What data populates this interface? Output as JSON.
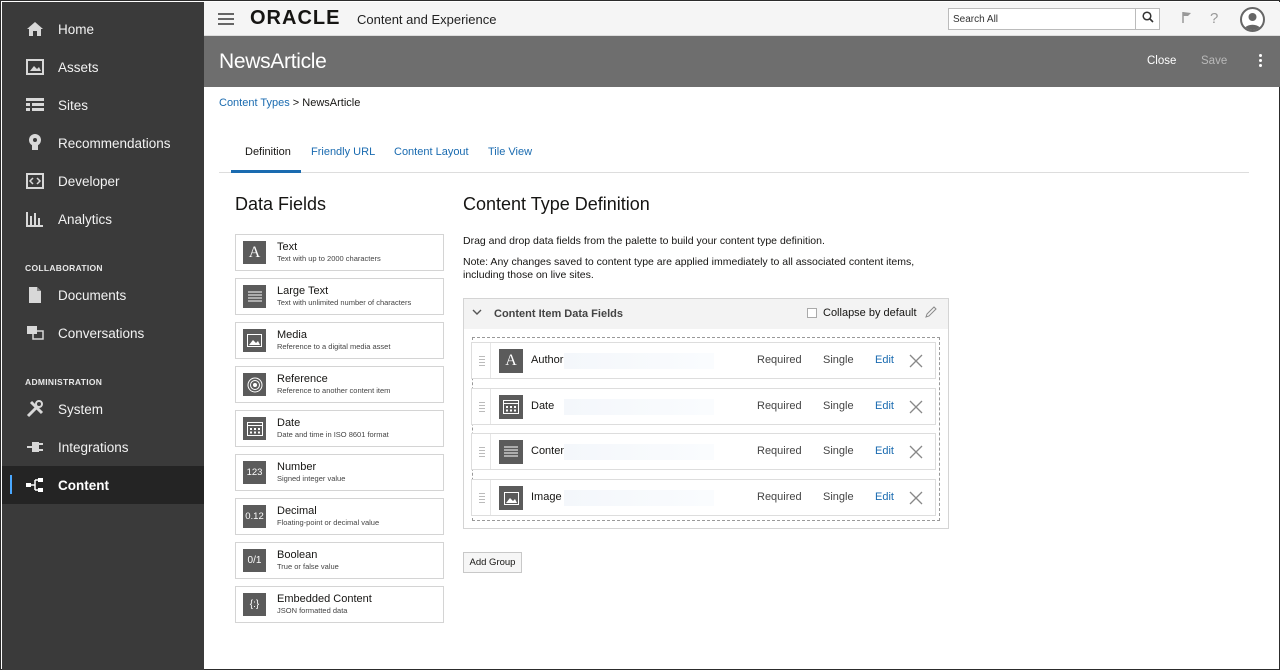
{
  "sidebar": {
    "items": [
      {
        "label": "Home",
        "icon": "home-icon"
      },
      {
        "label": "Assets",
        "icon": "image-icon"
      },
      {
        "label": "Sites",
        "icon": "list-icon"
      },
      {
        "label": "Recommendations",
        "icon": "lightbulb-icon"
      },
      {
        "label": "Developer",
        "icon": "code-icon"
      },
      {
        "label": "Analytics",
        "icon": "bar-chart-icon"
      },
      {
        "label": "Documents",
        "icon": "document-icon"
      },
      {
        "label": "Conversations",
        "icon": "chat-icon"
      },
      {
        "label": "System",
        "icon": "wrench-icon"
      },
      {
        "label": "Integrations",
        "icon": "plug-icon"
      },
      {
        "label": "Content",
        "icon": "content-tree-icon"
      }
    ],
    "sections": {
      "collaboration": "COLLABORATION",
      "administration": "ADMINISTRATION"
    }
  },
  "topbar": {
    "logo": "ORACLE",
    "app_title": "Content and Experience",
    "search_placeholder": "Search All"
  },
  "header": {
    "title": "NewsArticle",
    "close_label": "Close",
    "save_label": "Save"
  },
  "breadcrumb": {
    "parent": "Content Types",
    "separator": ">",
    "current": "NewsArticle"
  },
  "tabs": [
    {
      "label": "Definition",
      "active": true
    },
    {
      "label": "Friendly URL",
      "active": false
    },
    {
      "label": "Content Layout",
      "active": false
    },
    {
      "label": "Tile View",
      "active": false
    }
  ],
  "palette": {
    "title": "Data Fields",
    "items": [
      {
        "name": "Text",
        "desc": "Text with up to 2000 characters",
        "icon": "A"
      },
      {
        "name": "Large Text",
        "desc": "Text with unlimited number of characters",
        "icon": "large-text-icon"
      },
      {
        "name": "Media",
        "desc": "Reference to a digital media asset",
        "icon": "media-icon"
      },
      {
        "name": "Reference",
        "desc": "Reference to another content item",
        "icon": "reference-icon"
      },
      {
        "name": "Date",
        "desc": "Date and time in ISO 8601 format",
        "icon": "calendar-icon"
      },
      {
        "name": "Number",
        "desc": "Signed integer value",
        "icon": "123"
      },
      {
        "name": "Decimal",
        "desc": "Floating-point or decimal value",
        "icon": "0.12"
      },
      {
        "name": "Boolean",
        "desc": "True or false value",
        "icon": "0/1"
      },
      {
        "name": "Embedded Content",
        "desc": "JSON formatted data",
        "icon": "{:}"
      }
    ]
  },
  "definition": {
    "title": "Content Type Definition",
    "instructions": "Drag and drop data fields from the palette to build your content type definition.",
    "note_line1": "Note: Any changes saved to content type are applied immediately to all associated content items,",
    "note_line2": "including those on live sites.",
    "group": {
      "name": "Content Item Data Fields",
      "collapse_label": "Collapse by default",
      "collapse_checked": false
    },
    "fields": [
      {
        "name": "Author",
        "required": "Required",
        "cardinality": "Single",
        "edit": "Edit",
        "icon": "text-field-icon"
      },
      {
        "name": "Date",
        "required": "Required",
        "cardinality": "Single",
        "edit": "Edit",
        "icon": "calendar-icon"
      },
      {
        "name": "Content",
        "required": "Required",
        "cardinality": "Single",
        "edit": "Edit",
        "icon": "large-text-icon"
      },
      {
        "name": "Image",
        "required": "Required",
        "cardinality": "Single",
        "edit": "Edit",
        "icon": "media-icon"
      }
    ],
    "add_group_label": "Add Group"
  },
  "colors": {
    "sidebar": "#3a3a3a",
    "header": "#6e6e6e",
    "link": "#1a6bb0"
  }
}
